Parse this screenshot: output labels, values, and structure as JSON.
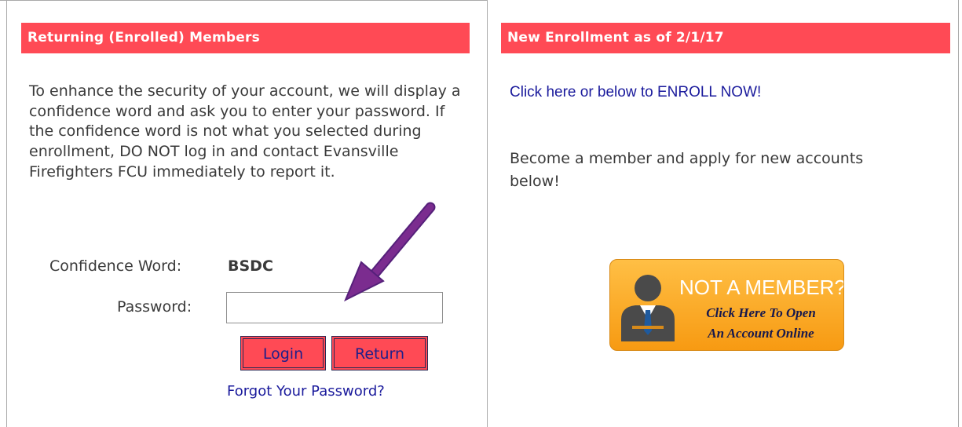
{
  "left_panel": {
    "header": "Returning (Enrolled) Members",
    "paragraph": "To enhance the security of your account, we will display a confidence word and ask you to enter your password. If the confidence word is not what you selected during enrollment, DO NOT log in and contact Evansville Firefighters FCU immediately to report it.",
    "confidence_label": "Confidence Word:",
    "confidence_value": "BSDC",
    "password_label": "Password:",
    "password_value": "",
    "login_label": "Login",
    "return_label": "Return",
    "forgot_link": "Forgot Your Password?"
  },
  "right_panel": {
    "header": "New Enrollment as of 2/1/17",
    "enroll_link": "Click here or below to ENROLL NOW!",
    "paragraph": "Become a member and apply for new accounts below!",
    "ad": {
      "title": "NOT A MEMBER?",
      "line1": "Click Here To Open",
      "line2": "An Account Online",
      "icon": "person-icon"
    }
  },
  "colors": {
    "header_bg": "#ff4a55",
    "link": "#1a1a9c",
    "annotation_arrow": "#7b2c8f"
  }
}
